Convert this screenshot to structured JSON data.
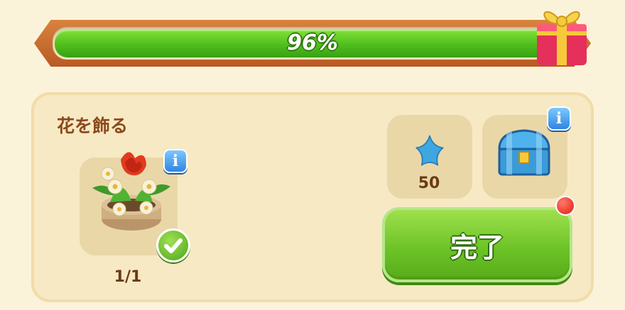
{
  "event_progress": {
    "percent_label": "96%",
    "percent": 96,
    "reward_icon": "gift-box-icon"
  },
  "task": {
    "title": "花を飾る",
    "item_icon": "flower-pot-icon",
    "progress": "1/1",
    "completed": true
  },
  "rewards": [
    {
      "icon": "blue-star-icon",
      "amount": "50"
    },
    {
      "icon": "blue-treasure-chest-icon",
      "amount": ""
    }
  ],
  "actions": {
    "complete_label": "完了",
    "has_notification": true
  },
  "colors": {
    "progress_green": "#4fbf1c",
    "frame_orange": "#c8682d",
    "button_green": "#6dc427",
    "info_blue": "#2f86e0",
    "notification_red": "#e01c10"
  }
}
